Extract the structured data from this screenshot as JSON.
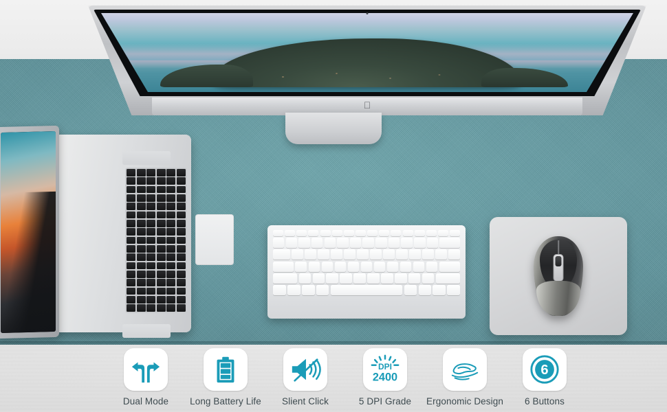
{
  "scene": {
    "description": "Wireless mouse lifestyle product photo with desk setup and feature icon strip",
    "colors": {
      "wall": "#eeeeee",
      "desk_mat": "#5e949c",
      "feature_bar": "#d8d8d8",
      "accent_teal": "#1a9cb8",
      "label_text": "#3d4a4f",
      "tile_white": "#ffffff"
    }
  },
  "desk": {
    "monitor": {
      "name": "imac-display",
      "brand_glyph": "apple-logo",
      "wallpaper": "island-at-dusk"
    },
    "laptop": {
      "name": "macbook-pro",
      "wallpaper": "orange-mountain-sunset"
    },
    "keyboard": {
      "name": "apple-magic-keyboard"
    },
    "mousepad": {
      "name": "mousepad"
    },
    "mouse": {
      "name": "wireless-mouse",
      "colors": [
        "black",
        "silver"
      ]
    }
  },
  "features": [
    {
      "id": "dual-mode",
      "icon": "dual-arrows-icon",
      "label": "Dual Mode"
    },
    {
      "id": "long-battery",
      "icon": "battery-icon",
      "label": "Long Battery Life"
    },
    {
      "id": "silent-click",
      "icon": "muted-speaker-icon",
      "label": "Slient Click"
    },
    {
      "id": "dpi-grade",
      "icon": "dpi-burst-icon",
      "label": "5 DPI Grade",
      "icon_text_top": "DPI",
      "icon_text_bottom": "2400"
    },
    {
      "id": "ergonomic-design",
      "icon": "hand-on-mouse-icon",
      "label": "Ergonomic Design"
    },
    {
      "id": "six-buttons",
      "icon": "number-circle-icon",
      "label": "6 Buttons",
      "icon_text": "6"
    }
  ]
}
